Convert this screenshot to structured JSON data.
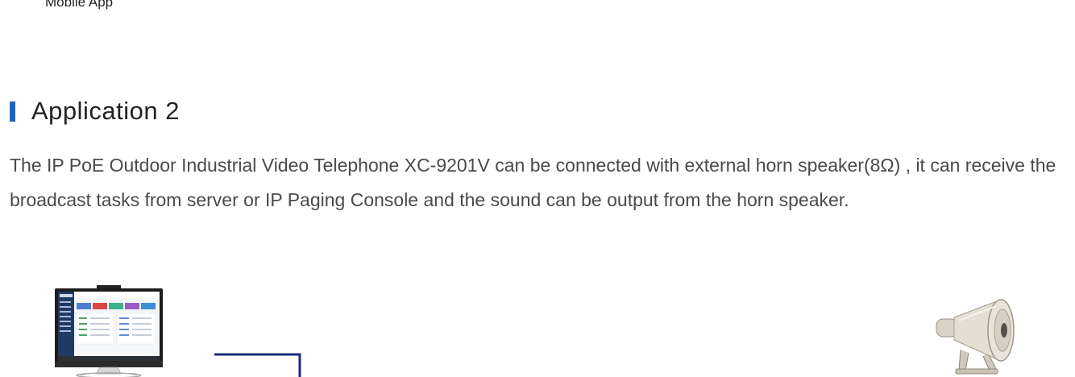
{
  "previous_section": {
    "caption": "Mobile App"
  },
  "section": {
    "title": "Application 2",
    "marker_color": "#1565c8",
    "description": "The IP PoE Outdoor Industrial Video Telephone XC-9201V can be connected with external horn speaker(8Ω) , it can receive the broadcast tasks from server or IP Paging Console and the sound can be output from the horn speaker."
  },
  "diagram": {
    "devices": [
      {
        "icon": "desktop-computer-icon"
      },
      {
        "icon": "horn-speaker-icon"
      }
    ],
    "line_color": "#1b2a7a"
  }
}
